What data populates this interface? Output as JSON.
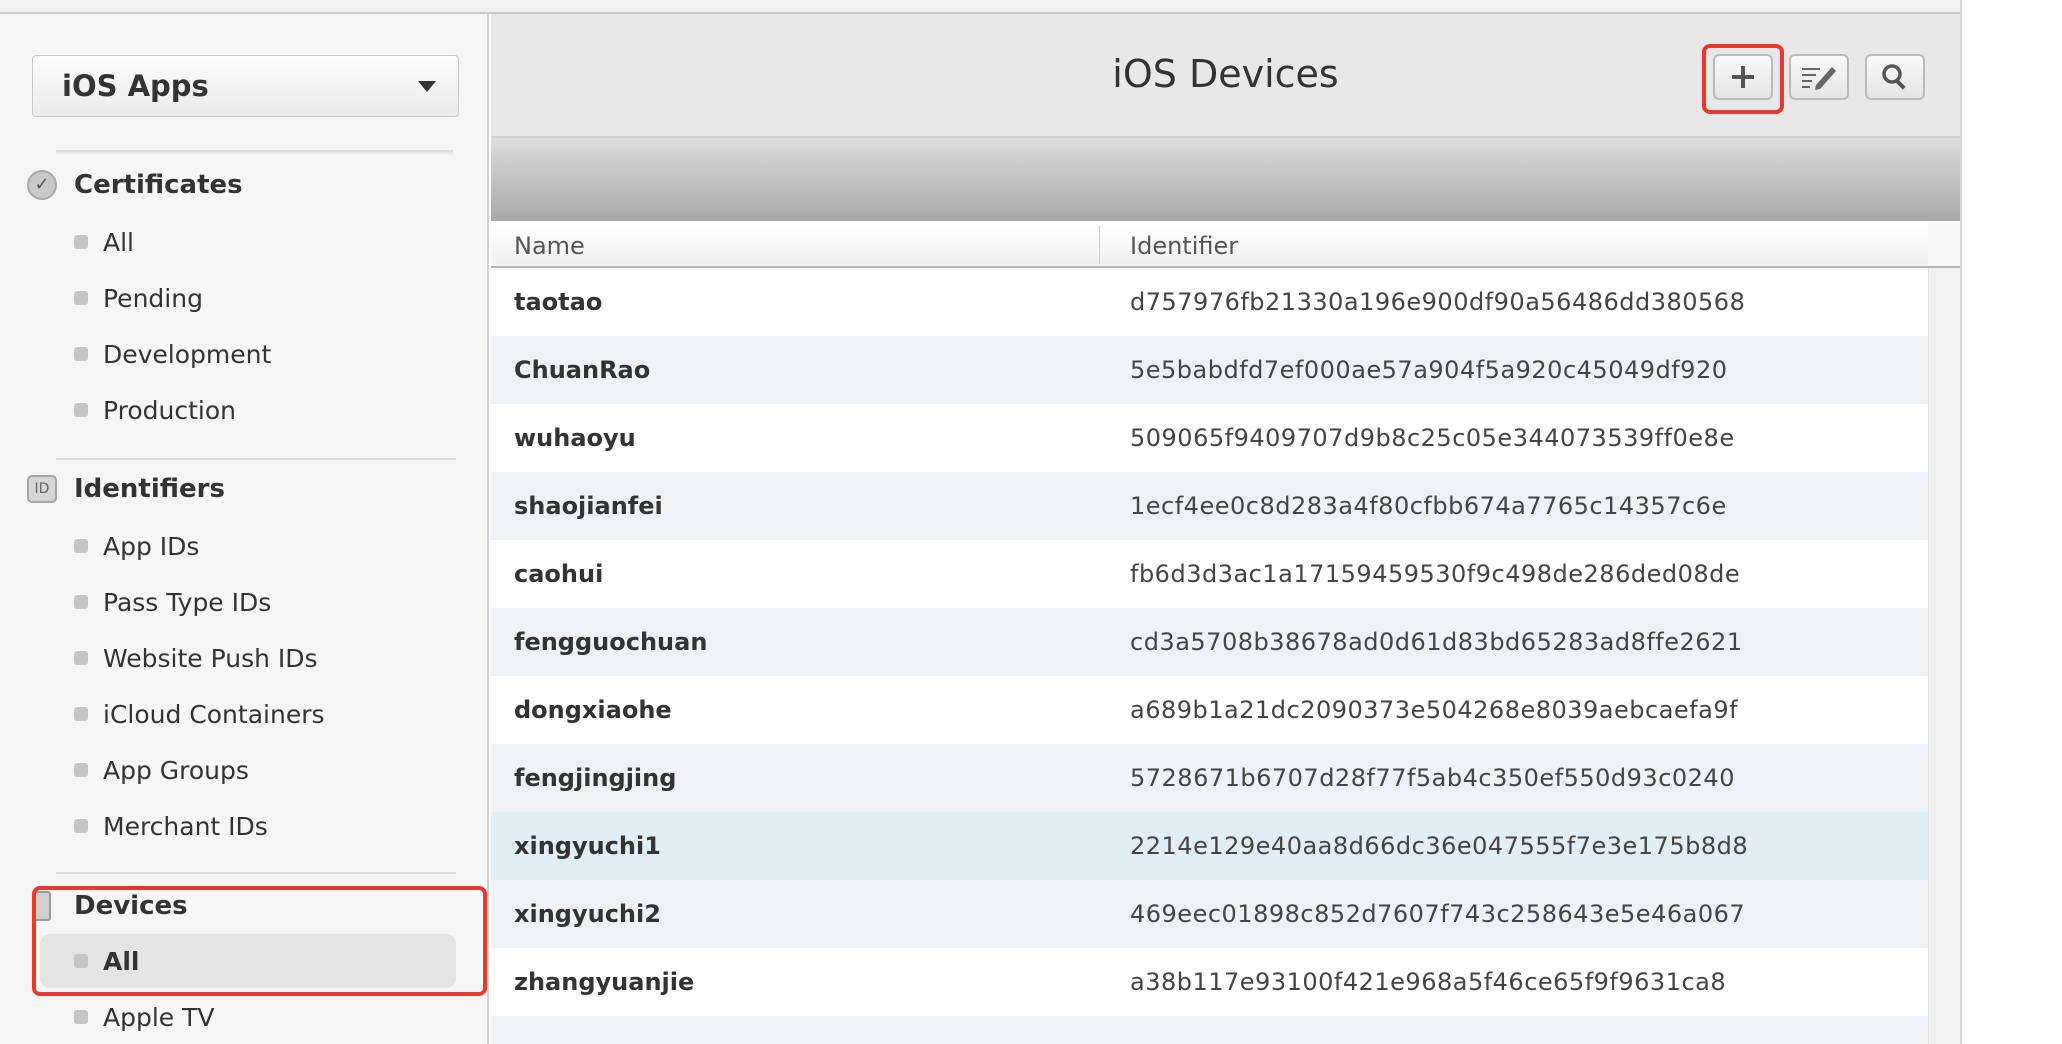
{
  "sidebar": {
    "app_selector": "iOS Apps",
    "certificates": {
      "title": "Certificates",
      "items": [
        "All",
        "Pending",
        "Development",
        "Production"
      ]
    },
    "identifiers": {
      "title": "Identifiers",
      "icon_text": "ID",
      "items": [
        "App IDs",
        "Pass Type IDs",
        "Website Push IDs",
        "iCloud Containers",
        "App Groups",
        "Merchant IDs"
      ]
    },
    "devices": {
      "title": "Devices",
      "items": [
        "All",
        "Apple TV"
      ],
      "active_item": "All"
    }
  },
  "header": {
    "title": "iOS Devices",
    "add_icon": "plus-icon",
    "edit_icon": "edit-icon",
    "search_icon": "search-icon"
  },
  "table": {
    "columns": [
      "Name",
      "Identifier"
    ],
    "rows": [
      {
        "name": "taotao",
        "identifier": "d757976fb21330a196e900df90a56486dd380568"
      },
      {
        "name": "ChuanRao",
        "identifier": "5e5babdfd7ef000ae57a904f5a920c45049df920"
      },
      {
        "name": "wuhaoyu",
        "identifier": "509065f9409707d9b8c25c05e344073539ff0e8e"
      },
      {
        "name": "shaojianfei",
        "identifier": "1ecf4ee0c8d283a4f80cfbb674a7765c14357c6e"
      },
      {
        "name": "caohui",
        "identifier": "fb6d3d3ac1a17159459530f9c498de286ded08de"
      },
      {
        "name": "fengguochuan",
        "identifier": "cd3a5708b38678ad0d61d83bd65283ad8ffe2621"
      },
      {
        "name": "dongxiaohe",
        "identifier": "a689b1a21dc2090373e504268e8039aebcaefa9f"
      },
      {
        "name": "fengjingjing",
        "identifier": "5728671b6707d28f77f5ab4c350ef550d93c0240"
      },
      {
        "name": "xingyuchi1",
        "identifier": "2214e129e40aa8d66dc36e047555f7e3e175b8d8"
      },
      {
        "name": "xingyuchi2",
        "identifier": "469eec01898c852d7607f743c258643e5e46a067"
      },
      {
        "name": "zhangyuanjie",
        "identifier": "a38b117e93100f421e968a5f46ce65f9f9631ca8"
      }
    ]
  },
  "colors": {
    "highlight": "#e8392c",
    "row_alt": "#eef2f7",
    "row_hover": "#e2eef6"
  }
}
